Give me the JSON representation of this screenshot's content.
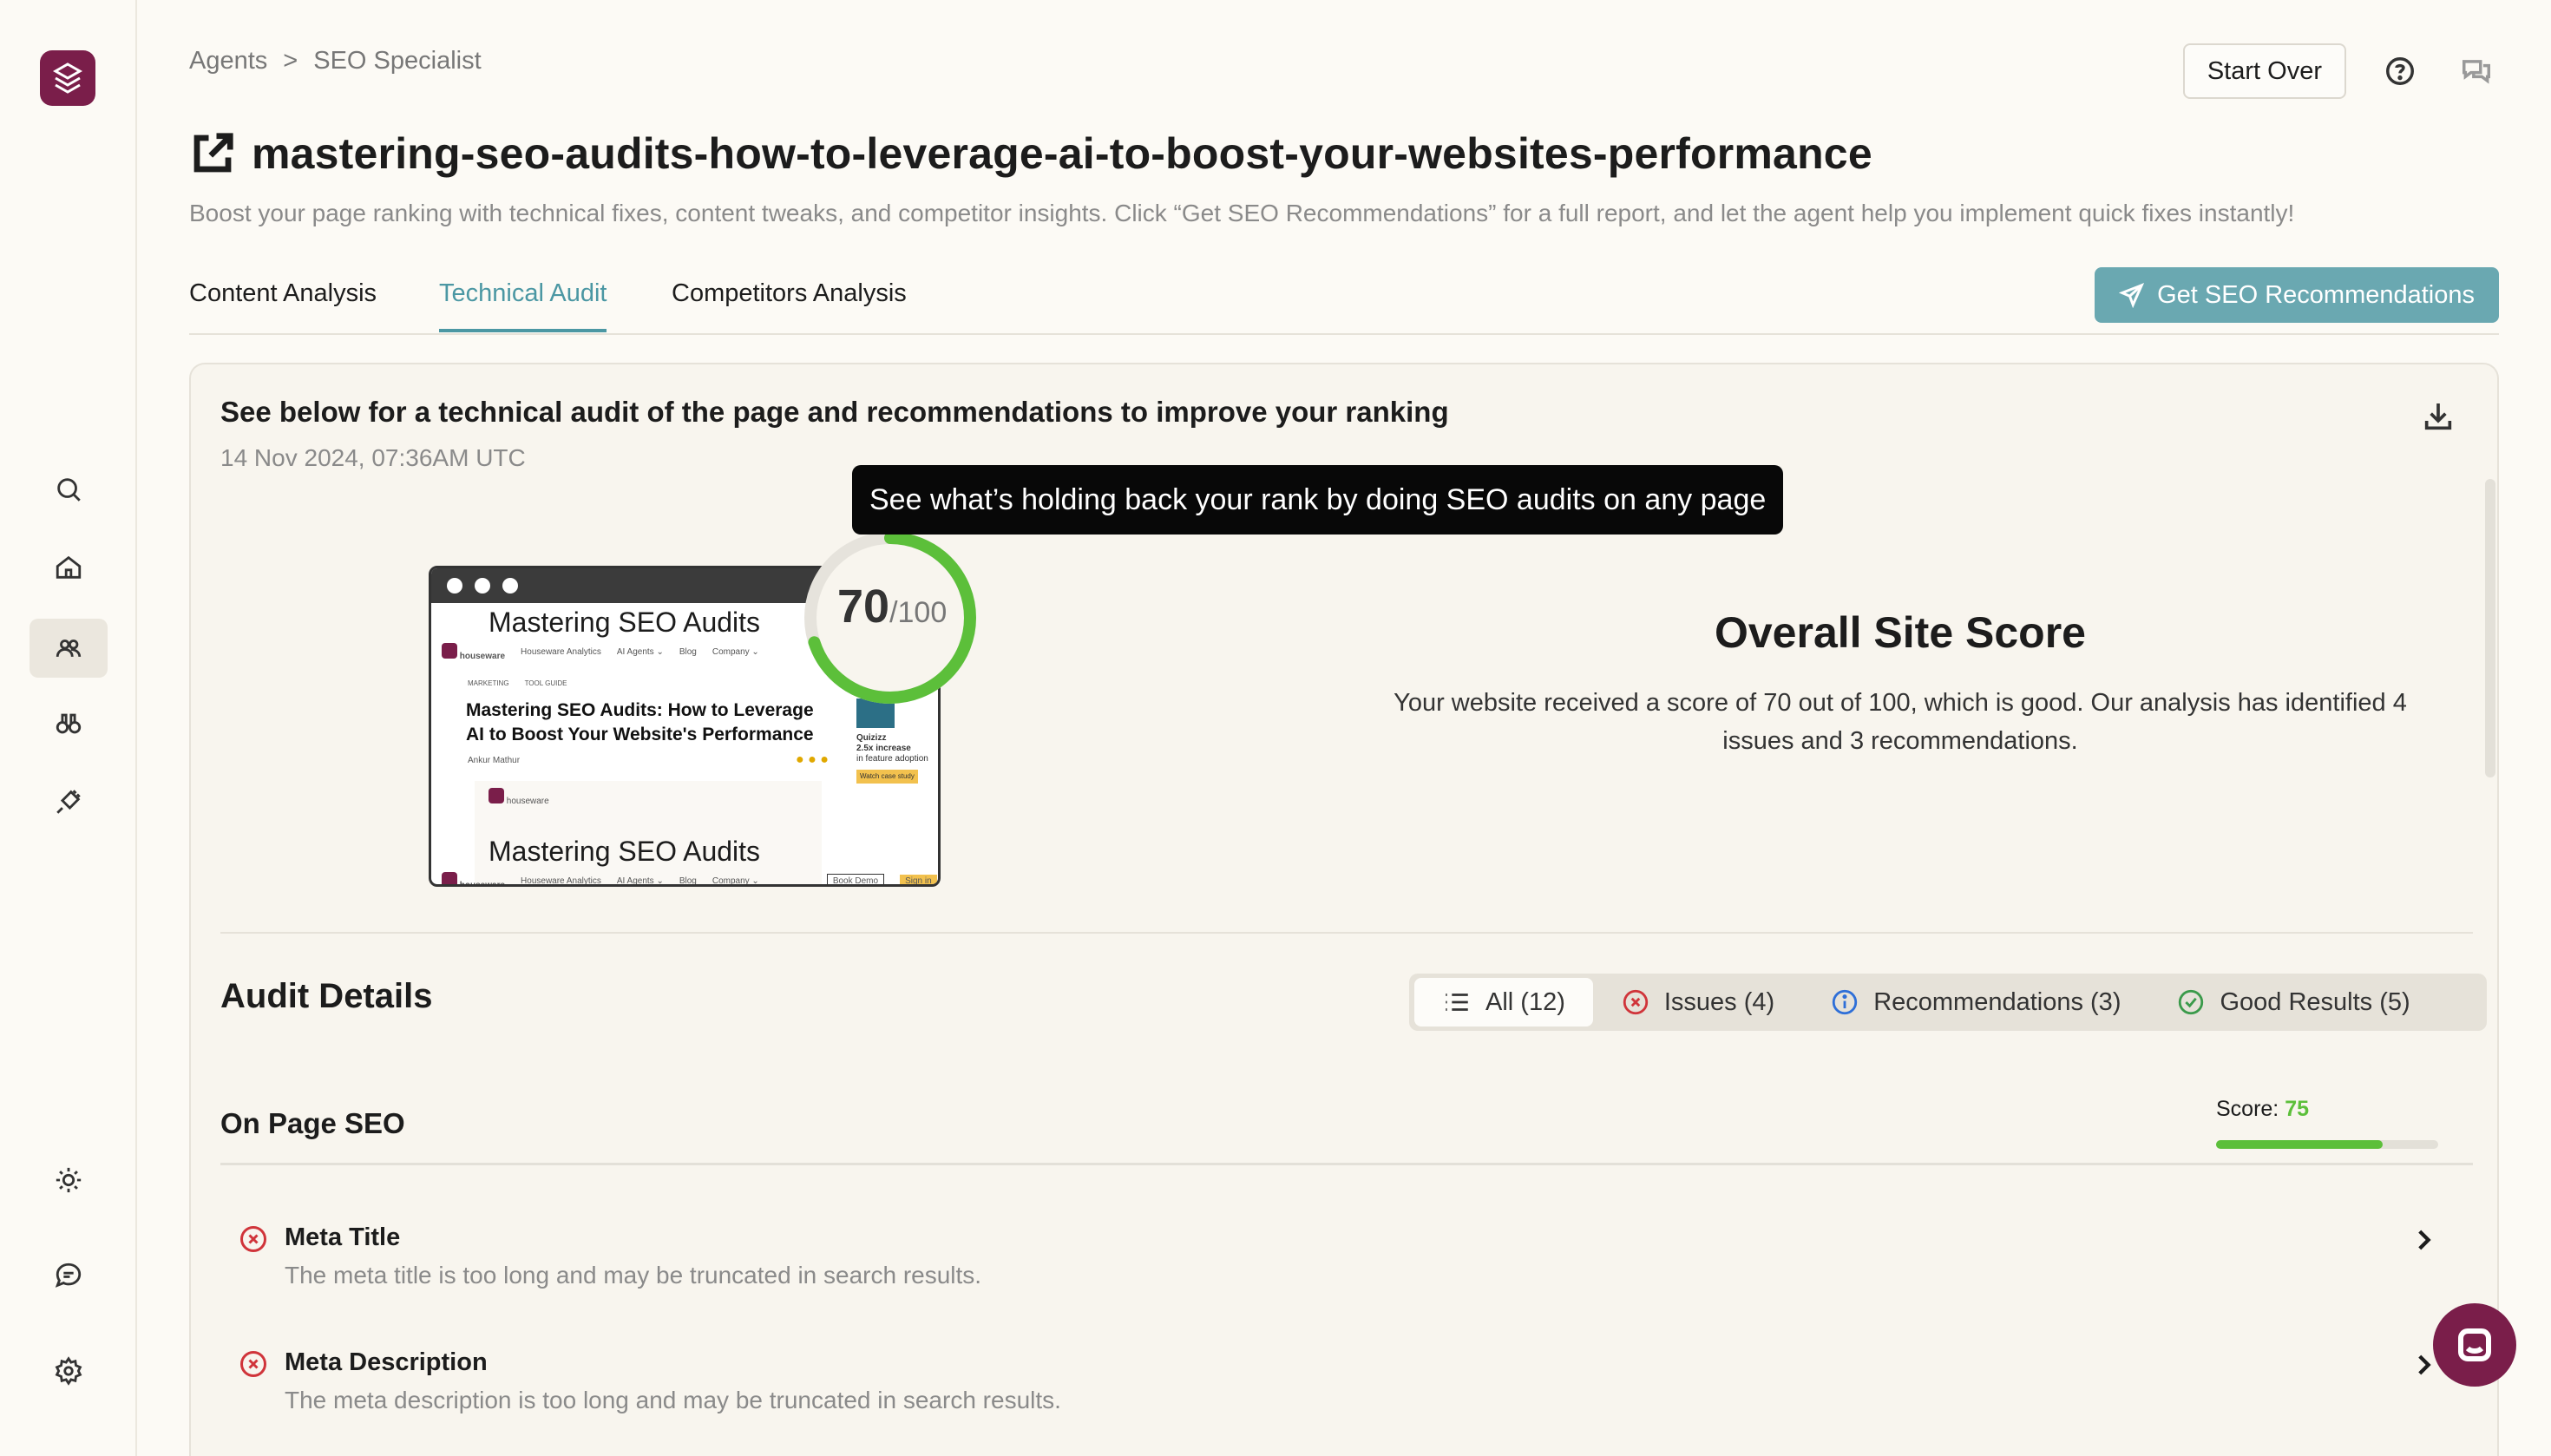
{
  "breadcrumb": {
    "root": "Agents",
    "separator": ">",
    "current": "SEO Specialist"
  },
  "header": {
    "start_over": "Start Over",
    "title": "mastering-seo-audits-how-to-leverage-ai-to-boost-your-websites-performance",
    "subtitle": "Boost your page ranking with technical fixes, content tweaks, and competitor insights. Click “Get SEO Recommendations” for a full report, and let the agent help you implement quick fixes instantly!"
  },
  "tabs": [
    {
      "label": "Content Analysis"
    },
    {
      "label": "Technical Audit"
    },
    {
      "label": "Competitors Analysis"
    }
  ],
  "active_tab": "Technical Audit",
  "primary_button": "Get SEO Recommendations",
  "card": {
    "heading": "See below for a technical audit of the page and recommendations to improve your ranking",
    "date": "14 Nov 2024, 07:36AM UTC"
  },
  "tooltip": "See what’s holding back your rank by doing SEO audits on any page",
  "preview": {
    "heading": "Mastering SEO Audits",
    "brand": "houseware",
    "nav": [
      "Houseware Analytics",
      "AI Agents ⌄",
      "Blog",
      "Company ⌄"
    ],
    "tags": [
      "MARKETING",
      "TOOL GUIDE"
    ],
    "article_title": "Mastering SEO Audits: How to Leverage AI to Boost Your Website's Performance",
    "author": "Ankur Mathur",
    "side_brand": "Quizizz",
    "side_stat": "2.5x increase",
    "side_sub": "in feature adoption",
    "side_cta": "Watch case study",
    "footer_heading": "Mastering SEO Audits",
    "btn_demo": "Book Demo",
    "btn_sign": "Sign in"
  },
  "score": {
    "value": "70",
    "max": "/100",
    "fraction": 0.7,
    "color": "#5cbf3a"
  },
  "overall": {
    "title": "Overall Site Score",
    "description": "Your website received a score of 70 out of 100, which is good. Our analysis has identified 4 issues and 3 recommendations."
  },
  "audit": {
    "title": "Audit Details",
    "filters": [
      {
        "label": "All (12)"
      },
      {
        "label": "Issues (4)"
      },
      {
        "label": "Recommendations (3)"
      },
      {
        "label": "Good Results (5)"
      }
    ],
    "section": {
      "title": "On Page SEO",
      "score_label": "Score:",
      "score": "75",
      "score_fraction": 0.75
    },
    "items": [
      {
        "name": "Meta Title",
        "desc": "The meta title is too long and may be truncated in search results."
      },
      {
        "name": "Meta Description",
        "desc": "The meta description is too long and may be truncated in search results."
      }
    ]
  },
  "colors": {
    "accent": "#4b97a3",
    "primary_button": "#6aa8b1",
    "brand": "#7a1e4a",
    "good": "#5cbf3a",
    "issue": "#d0343a",
    "info": "#2e6fd8"
  }
}
